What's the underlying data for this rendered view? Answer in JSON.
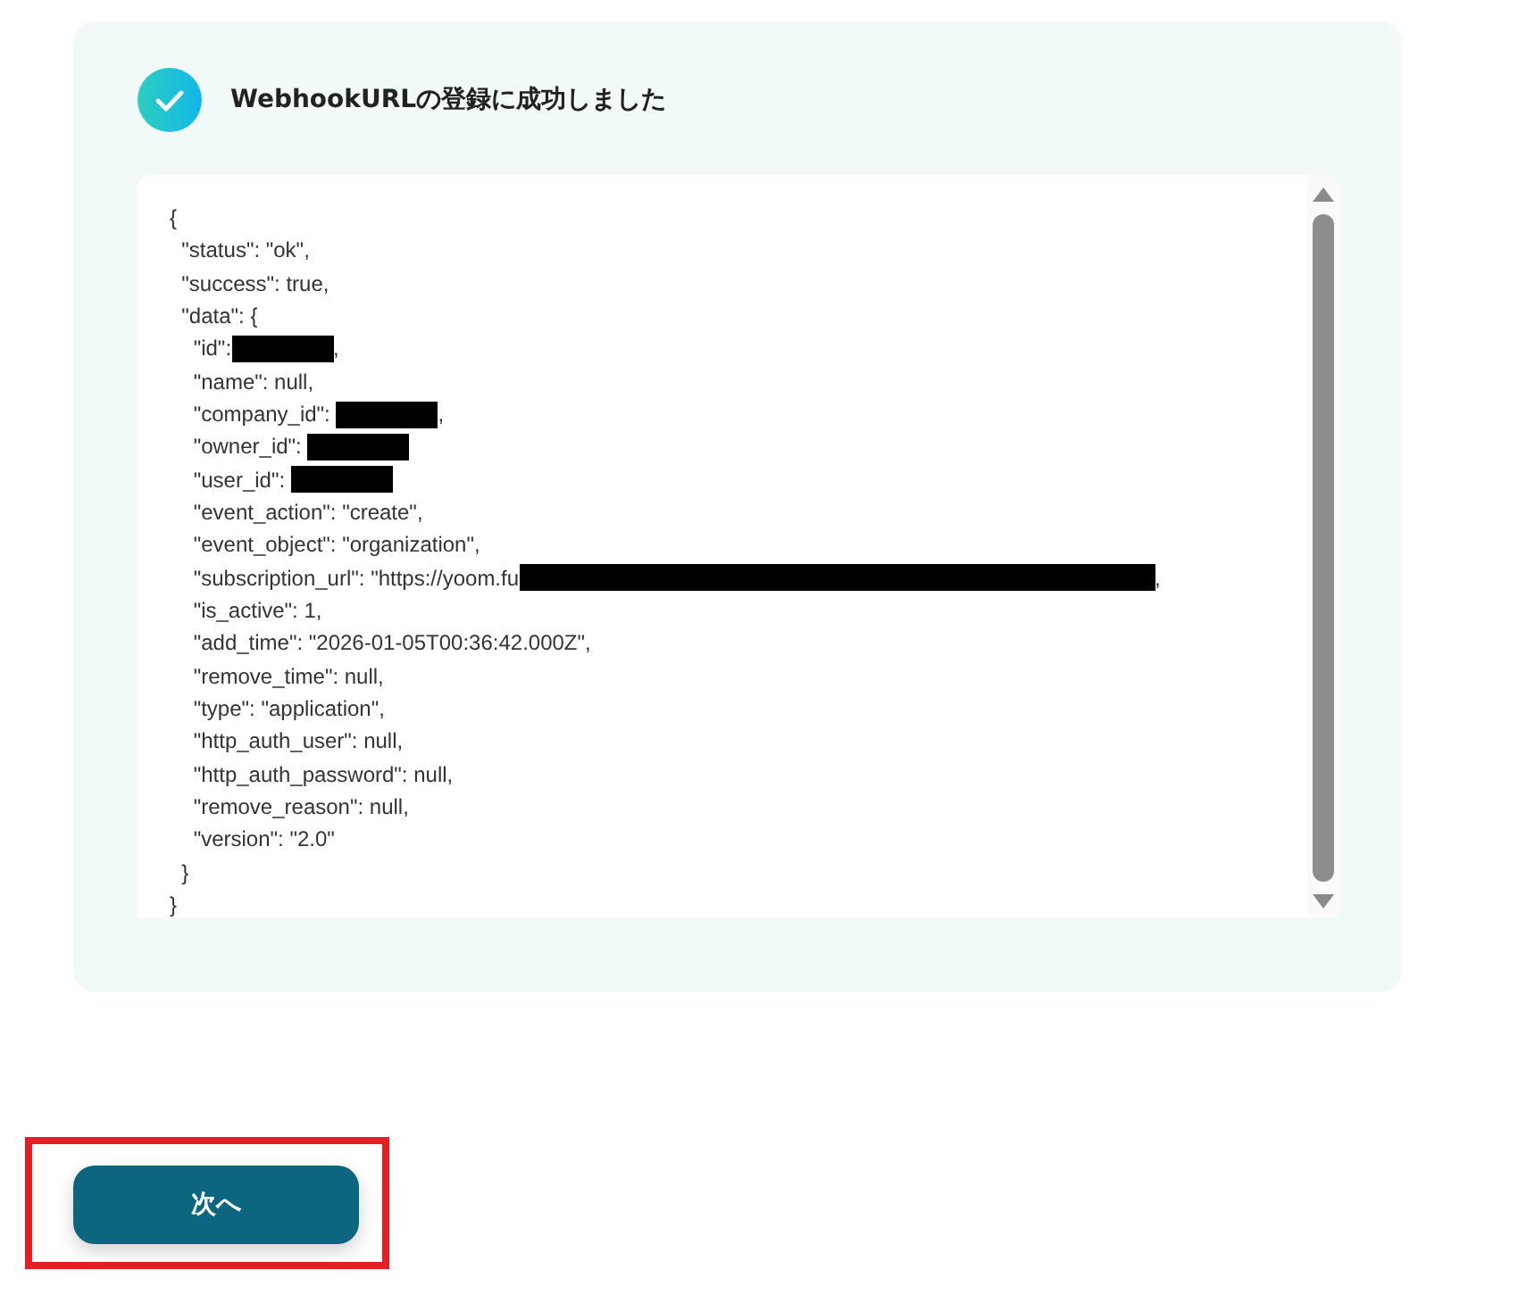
{
  "result_panel": {
    "succeeded": true,
    "title": "WebhookURLの登録に成功しました",
    "response_lines": [
      {
        "text": "{"
      },
      {
        "text": "  \"status\": \"ok\","
      },
      {
        "text": "  \"success\": true,"
      },
      {
        "text": "  \"data\": {"
      },
      {
        "text": "    \"id\":",
        "redacted": true,
        "after": ","
      },
      {
        "text": "    \"name\": null,"
      },
      {
        "text": "    \"company_id\": ",
        "redacted": true,
        "after": ","
      },
      {
        "text": "    \"owner_id\": ",
        "redacted": true
      },
      {
        "text": "    \"user_id\": ",
        "redacted": true
      },
      {
        "text": "    \"event_action\": \"create\","
      },
      {
        "text": "    \"event_object\": \"organization\","
      },
      {
        "text": "    \"subscription_url\": \"https://yoom.fu",
        "redacted": true,
        "wide": true,
        "after": ","
      },
      {
        "text": "    \"is_active\": 1,"
      },
      {
        "text": "    \"add_time\": \"2026-01-05T00:36:42.000Z\","
      },
      {
        "text": "    \"remove_time\": null,"
      },
      {
        "text": "    \"type\": \"application\","
      },
      {
        "text": "    \"http_auth_user\": null,"
      },
      {
        "text": "    \"http_auth_password\": null,"
      },
      {
        "text": "    \"remove_reason\": null,"
      },
      {
        "text": "    \"version\": \"2.0\""
      },
      {
        "text": "  }"
      },
      {
        "text": "}"
      }
    ]
  },
  "next_button": {
    "label": "次へ",
    "highlighted": true
  }
}
